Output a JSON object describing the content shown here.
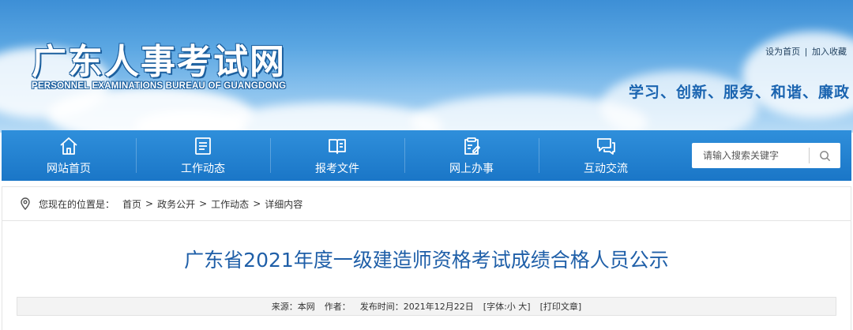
{
  "header": {
    "title": "广东人事考试网",
    "subtitle": "PERSONNEL EXAMINATIONS BUREAU OF GUANGDONG",
    "links": [
      {
        "label": "设为首页"
      },
      {
        "label": "加入收藏"
      }
    ],
    "link_separator": "|",
    "slogan": "学习、创新、服务、和谐、廉政"
  },
  "nav": {
    "items": [
      {
        "label": "网站首页",
        "icon": "home-icon"
      },
      {
        "label": "工作动态",
        "icon": "news-list-icon"
      },
      {
        "label": "报考文件",
        "icon": "book-icon"
      },
      {
        "label": "网上办事",
        "icon": "clipboard-edit-icon"
      },
      {
        "label": "互动交流",
        "icon": "chat-icon"
      }
    ],
    "search": {
      "placeholder": "请输入搜索关键字",
      "icon": "search-icon"
    }
  },
  "breadcrumb": {
    "icon": "location-pin-icon",
    "label": "您现在的位置是：",
    "separator": ">",
    "items": [
      "首页",
      "政务公开",
      "工作动态",
      "详细内容"
    ]
  },
  "article": {
    "title": "广东省2021年度一级建造师资格考试成绩合格人员公示",
    "meta": {
      "source_label": "来源：",
      "source": "本网",
      "author_label": "作者：",
      "author": "",
      "date_label": "发布时间：",
      "date": "2021年12月22日",
      "font_label": "[字体:",
      "font_small": "小",
      "font_large": "大",
      "font_close": "]",
      "print": "[打印文章]"
    }
  },
  "colors": {
    "nav_bg": "#1a76c7",
    "title_blue": "#1f5fa8",
    "slogan_blue": "#1a64b0"
  }
}
